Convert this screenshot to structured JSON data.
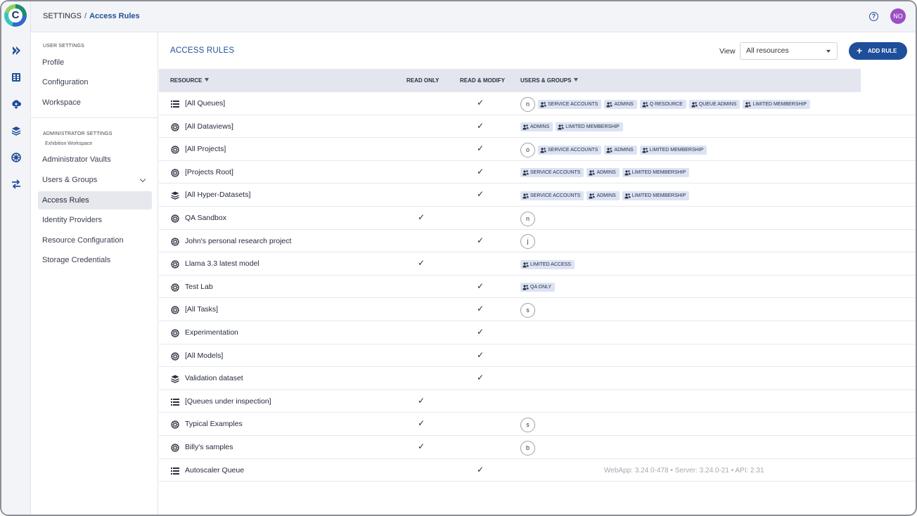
{
  "header": {
    "breadcrumb_root": "SETTINGS",
    "breadcrumb_sep": "/",
    "breadcrumb_current": "Access Rules",
    "help_glyph": "?",
    "avatar_initials": "NO"
  },
  "logo": {
    "letter": "C"
  },
  "rail": {
    "icons": [
      "pipelines-icon",
      "datasets-icon",
      "models-icon",
      "hyper-datasets-icon",
      "orchestration-icon",
      "applications-icon"
    ]
  },
  "sidebar": {
    "user_settings_heading": "USER SETTINGS",
    "user_items": [
      "Profile",
      "Configuration",
      "Workspace"
    ],
    "admin_settings_heading": "ADMINISTRATOR SETTINGS",
    "admin_workspace": "Exhibition Workspace",
    "admin_items": [
      "Administrator Vaults",
      "Users & Groups",
      "Access Rules",
      "Identity Providers",
      "Resource Configuration",
      "Storage Credentials"
    ],
    "active_item": "Access Rules"
  },
  "main": {
    "title": "ACCESS RULES",
    "view_label": "View",
    "view_value": "All resources",
    "add_rule_label": "ADD RULE",
    "columns": {
      "resource": "RESOURCE",
      "read_only": "READ ONLY",
      "read_modify": "READ & MODIFY",
      "users_groups": "USERS & GROUPS"
    },
    "check_glyph": "✓",
    "rows": [
      {
        "icon": "queue-icon",
        "name": "[All Queues]",
        "read_only": false,
        "read_modify": true,
        "users": [
          "n"
        ],
        "groups": [
          "SERVICE ACCOUNTS",
          "ADMINS",
          "Q RESOURCE",
          "QUEUE ADMINS",
          "LIMITED MEMBERSHIP"
        ]
      },
      {
        "icon": "project-icon",
        "name": "[All Dataviews]",
        "read_only": false,
        "read_modify": true,
        "users": [],
        "groups": [
          "ADMINS",
          "LIMITED MEMBERSHIP"
        ]
      },
      {
        "icon": "project-icon",
        "name": "[All Projects]",
        "read_only": false,
        "read_modify": true,
        "users": [
          "o"
        ],
        "groups": [
          "SERVICE ACCOUNTS",
          "ADMINS",
          "LIMITED MEMBERSHIP"
        ]
      },
      {
        "icon": "project-icon",
        "name": "[Projects Root]",
        "read_only": false,
        "read_modify": true,
        "users": [],
        "groups": [
          "SERVICE ACCOUNTS",
          "ADMINS",
          "LIMITED MEMBERSHIP"
        ]
      },
      {
        "icon": "dataset-icon",
        "name": "[All Hyper-Datasets]",
        "read_only": false,
        "read_modify": true,
        "users": [],
        "groups": [
          "SERVICE ACCOUNTS",
          "ADMINS",
          "LIMITED MEMBERSHIP"
        ]
      },
      {
        "icon": "project-icon",
        "name": "QA Sandbox",
        "read_only": true,
        "read_modify": false,
        "users": [
          "n"
        ],
        "groups": []
      },
      {
        "icon": "project-icon",
        "name": "John's personal research project",
        "read_only": false,
        "read_modify": true,
        "users": [
          "j"
        ],
        "groups": []
      },
      {
        "icon": "project-icon",
        "name": "Llama 3.3 latest model",
        "read_only": true,
        "read_modify": false,
        "users": [],
        "groups": [
          "LIMITED ACCESS"
        ]
      },
      {
        "icon": "project-icon",
        "name": "Test Lab",
        "read_only": false,
        "read_modify": true,
        "users": [],
        "groups": [
          "QA ONLY"
        ]
      },
      {
        "icon": "project-icon",
        "name": "[All Tasks]",
        "read_only": false,
        "read_modify": true,
        "users": [
          "s"
        ],
        "groups": []
      },
      {
        "icon": "project-icon",
        "name": "Experimentation",
        "read_only": false,
        "read_modify": true,
        "users": [],
        "groups": []
      },
      {
        "icon": "project-icon",
        "name": "[All Models]",
        "read_only": false,
        "read_modify": true,
        "users": [],
        "groups": []
      },
      {
        "icon": "dataset-icon",
        "name": "Validation dataset",
        "read_only": false,
        "read_modify": true,
        "users": [],
        "groups": []
      },
      {
        "icon": "queue-icon",
        "name": "[Queues under inspection]",
        "read_only": true,
        "read_modify": false,
        "users": [],
        "groups": []
      },
      {
        "icon": "project-icon",
        "name": "Typical Examples",
        "read_only": true,
        "read_modify": false,
        "users": [
          "s"
        ],
        "groups": []
      },
      {
        "icon": "project-icon",
        "name": "Billy's samples",
        "read_only": true,
        "read_modify": false,
        "users": [
          "b"
        ],
        "groups": []
      },
      {
        "icon": "queue-icon",
        "name": "Autoscaler Queue",
        "read_only": false,
        "read_modify": true,
        "users": [],
        "groups": []
      }
    ]
  },
  "footer": {
    "version": "WebApp: 3.24.0-478 • Server: 3.24.0-21 • API: 2.31"
  },
  "colors": {
    "accent": "#1f4e9a",
    "tag_bg": "#dbe3f5",
    "avatar": "#9b4fc4"
  }
}
